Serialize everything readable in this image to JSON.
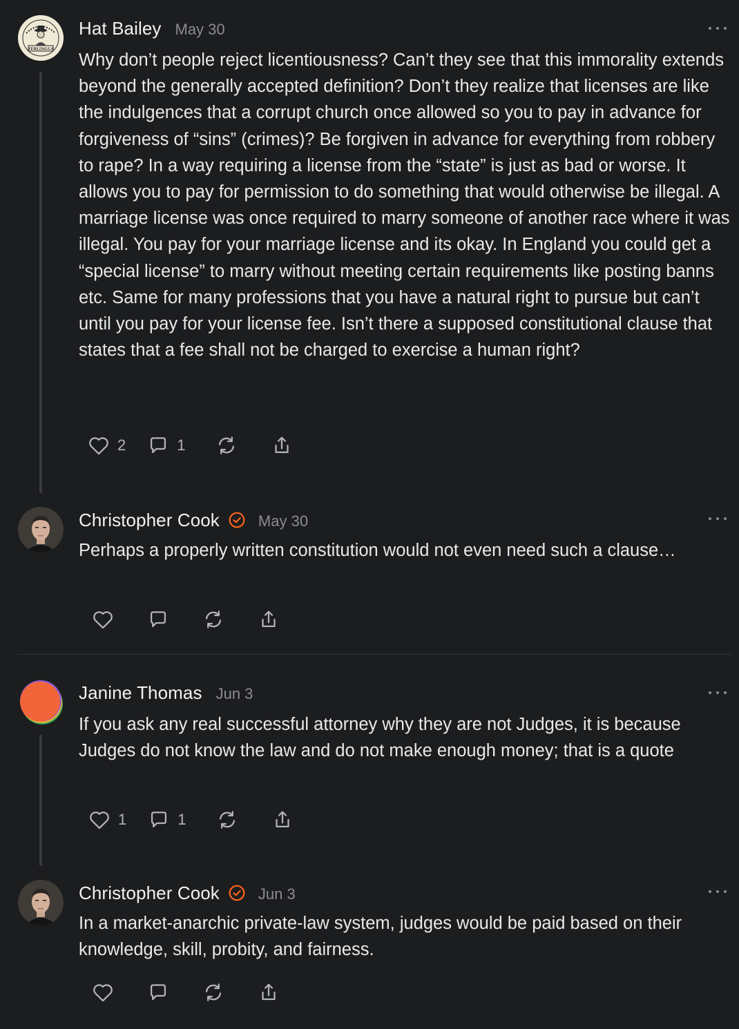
{
  "comments": [
    {
      "author": "Hat Bailey",
      "date": "May 30",
      "text": "Why don’t people reject licentiousness? Can’t they see that this immorality extends beyond the generally accepted definition? Don’t they realize that licenses are like the indulgences that a corrupt church once allowed so you to pay in advance for forgiveness of “sins” (crimes)? Be forgiven in advance for everything from robbery to rape? In a way requiring a license from the “state” is just as bad or worse. It allows you to pay for permission to do something that would otherwise be illegal. A marriage license was once required to marry someone of another race where it was illegal. You pay for your marriage license and its okay. In England you could get a “special license” to marry without meeting certain requirements like posting banns etc. Same for many professions that you have a natural right to pursue but can’t until you pay for your license fee. Isn’t there a supposed constitutional clause that states that a fee shall not be charged to exercise a human right?",
      "likes": "2",
      "replies": "1",
      "avatar_text": "TERLINGUA",
      "avatar_ring_text": "HAT BAILEY"
    },
    {
      "author": "Christopher Cook",
      "date": "May 30",
      "text": "Perhaps a properly written constitution would not even need such a clause…",
      "likes": "",
      "replies": ""
    },
    {
      "author": "Janine Thomas",
      "date": "Jun 3",
      "text": "If you ask any real successful attorney why they are not Judges, it is because Judges do not know the law and do not make enough money; that is a quote",
      "likes": "1",
      "replies": "1"
    },
    {
      "author": "Christopher Cook",
      "date": "Jun 3",
      "text": "In a market-anarchic private-law system, judges would be paid based on their knowledge, skill, probity, and fairness.",
      "likes": "",
      "replies": ""
    }
  ],
  "icons": {
    "like": "heart-icon",
    "reply": "comment-bubble-icon",
    "restack": "restack-icon",
    "share": "share-icon",
    "more": "more-dots-icon",
    "verified": "verified-check-icon"
  },
  "colors": {
    "background": "#1c1d1f",
    "text": "#e9e9ea",
    "muted": "#8b8c90",
    "accent": "#ff6719"
  }
}
